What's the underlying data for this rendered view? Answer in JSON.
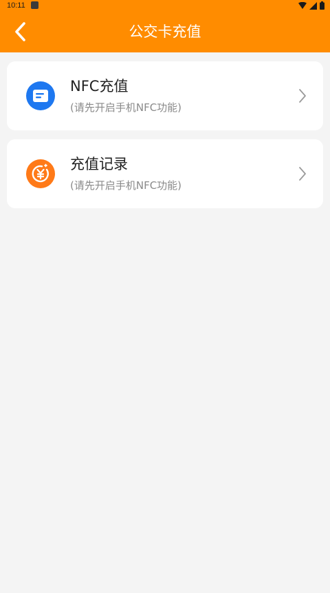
{
  "status_bar": {
    "time": "10:11"
  },
  "header": {
    "title": "公交卡充值",
    "background_color": "#ff8c00",
    "back_icon": "chevron-left-icon"
  },
  "cards": [
    {
      "title": "NFC充值",
      "subtitle": "(请先开启手机NFC功能)",
      "icon": "card-icon",
      "icon_color": "#1e78f0"
    },
    {
      "title": "充值记录",
      "subtitle": "(请先开启手机NFC功能)",
      "icon": "yen-record-icon",
      "icon_color": "#ff7a18"
    }
  ]
}
